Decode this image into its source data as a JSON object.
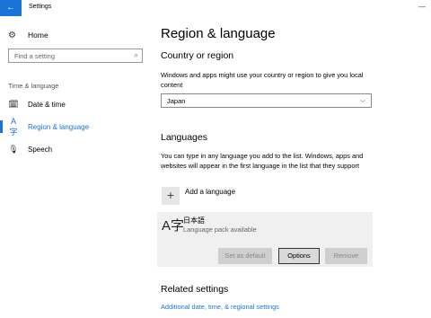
{
  "window": {
    "title": "Settings",
    "back_icon": "←",
    "minimize_icon": "—"
  },
  "sidebar": {
    "home": {
      "icon": "⚙",
      "label": "Home"
    },
    "search": {
      "placeholder": "Find a setting",
      "icon": "⌕"
    },
    "section_label": "Time & language",
    "items": [
      {
        "icon": "🗓",
        "label": "Date & time",
        "active": false
      },
      {
        "icon": "A字",
        "label": "Region & language",
        "active": true
      },
      {
        "icon": "🎙",
        "label": "Speech",
        "active": false
      }
    ]
  },
  "main": {
    "page_title": "Region & language",
    "country": {
      "heading": "Country or region",
      "description": "Windows and apps might use your country or region to give you local content",
      "selected": "Japan",
      "chevron": "⌵"
    },
    "languages": {
      "heading": "Languages",
      "description": "You can type in any language you add to the list. Windows, apps and websites will appear in the first language in the list that they support",
      "add_label": "Add a language",
      "add_icon": "+",
      "entry": {
        "icon": "A字",
        "name": "日本語",
        "status": "Language pack available",
        "buttons": {
          "set_default": "Set as default",
          "options": "Options",
          "remove": "Remove"
        }
      }
    },
    "related": {
      "heading": "Related settings",
      "link": "Additional date, time, & regional settings"
    }
  },
  "colors": {
    "accent": "#1a73d8",
    "card_bg": "#f0f0f0"
  }
}
